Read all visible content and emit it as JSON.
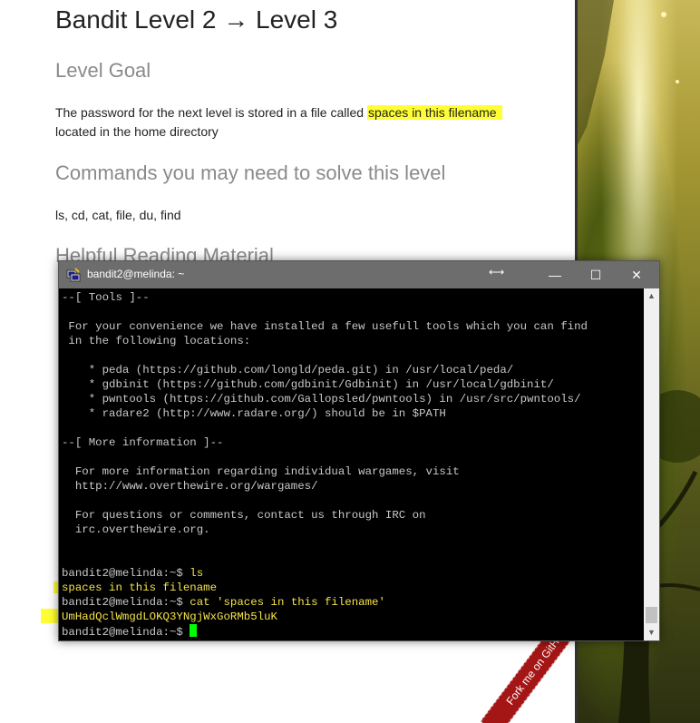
{
  "page": {
    "title": "Bandit Level 2 → Level 3",
    "goal_heading": "Level Goal",
    "goal_text_before": "The password for the next level is stored in a file called ",
    "goal_highlight": "spaces in this filename",
    "goal_text_after": "located in the home directory",
    "commands_heading": "Commands you may need to solve this level",
    "commands_text": "ls, cd, cat, file, du, find",
    "reading_heading": "Helpful Reading Material"
  },
  "ribbon": {
    "label": "Fork me on GitHub"
  },
  "terminal": {
    "window_title": "bandit2@melinda: ~",
    "icons": {
      "app": "putty-icon",
      "resize": "resize-arrows-icon",
      "minimize": "minimize-icon",
      "maximize": "maximize-icon",
      "close": "close-icon"
    },
    "buttons": {
      "minimize": "—",
      "maximize": "☐",
      "close": "✕"
    },
    "lines": {
      "l1": "--[ Tools ]--",
      "l2": " For your convenience we have installed a few usefull tools which you can find",
      "l3": " in the following locations:",
      "l4": "    * peda (https://github.com/longld/peda.git) in /usr/local/peda/",
      "l5": "    * gdbinit (https://github.com/gdbinit/Gdbinit) in /usr/local/gdbinit/",
      "l6": "    * pwntools (https://github.com/Gallopsled/pwntools) in /usr/src/pwntools/",
      "l7": "    * radare2 (http://www.radare.org/) should be in $PATH",
      "l8": "--[ More information ]--",
      "l9": "  For more information regarding individual wargames, visit",
      "l10": "  http://www.overthewire.org/wargames/",
      "l11": "  For questions or comments, contact us through IRC on",
      "l12": "  irc.overthewire.org.",
      "prompt1": "bandit2@melinda:~$ ",
      "cmd1": "ls",
      "out1": "spaces in this filename",
      "prompt2": "bandit2@melinda:~$ ",
      "cmd2": "cat 'spaces in this filename'",
      "out2": "UmHadQclWmgdLOKQ3YNgjWxGoRMb5luK",
      "prompt3": "bandit2@melinda:~$ "
    },
    "colors": {
      "background": "#000000",
      "text": "#c8c8c8",
      "highlight_text": "#f5e24a",
      "cursor": "#00ff00",
      "titlebar": "#6d6d6d"
    }
  },
  "colors": {
    "highlight": "#ffff33",
    "ribbon": "#a41515"
  }
}
